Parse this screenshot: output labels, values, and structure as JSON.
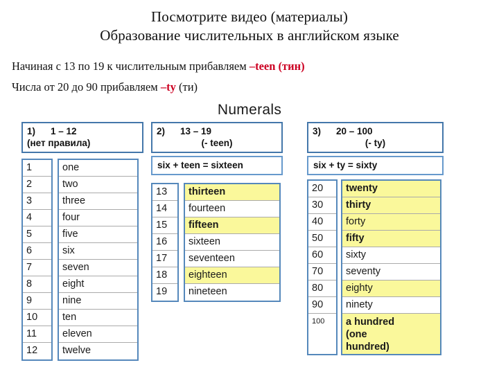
{
  "heading": {
    "line1": "Посмотрите видео (материалы)",
    "line2": "Образование числительных в английском языке"
  },
  "rules": {
    "rule1_prefix": "Начиная с 13 по 19 к числительным прибавляем ",
    "rule1_accent": "–teen (тин)",
    "rule2_prefix": "Числа от 20 до 90 прибавляем ",
    "rule2_accent": "–ty",
    "rule2_suffix": " (ти)"
  },
  "figure": {
    "title": "Numerals",
    "accent_color": "#CC0022",
    "highlight_color": "#FAF89B",
    "border_color": "#5588BB",
    "columns": [
      {
        "index": "1)",
        "range": "1 – 12",
        "subtitle": "(нет правила)",
        "formula": null,
        "rows": [
          {
            "num": "1",
            "word": "one",
            "highlight": false,
            "bold": false
          },
          {
            "num": "2",
            "word": "two",
            "highlight": false,
            "bold": false
          },
          {
            "num": "3",
            "word": "three",
            "highlight": false,
            "bold": false
          },
          {
            "num": "4",
            "word": "four",
            "highlight": false,
            "bold": false
          },
          {
            "num": "5",
            "word": "five",
            "highlight": false,
            "bold": false
          },
          {
            "num": "6",
            "word": "six",
            "highlight": false,
            "bold": false
          },
          {
            "num": "7",
            "word": "seven",
            "highlight": false,
            "bold": false
          },
          {
            "num": "8",
            "word": "eight",
            "highlight": false,
            "bold": false
          },
          {
            "num": "9",
            "word": "nine",
            "highlight": false,
            "bold": false
          },
          {
            "num": "10",
            "word": "ten",
            "highlight": false,
            "bold": false
          },
          {
            "num": "11",
            "word": "eleven",
            "highlight": false,
            "bold": false
          },
          {
            "num": "12",
            "word": "twelve",
            "highlight": false,
            "bold": false
          }
        ]
      },
      {
        "index": "2)",
        "range": "13 – 19",
        "subtitle": "(- teen)",
        "formula": "six + teen = sixteen",
        "rows": [
          {
            "num": "13",
            "word": "thirteen",
            "highlight": true,
            "bold": true
          },
          {
            "num": "14",
            "word": "fourteen",
            "highlight": false,
            "bold": false
          },
          {
            "num": "15",
            "word": "fifteen",
            "highlight": true,
            "bold": true
          },
          {
            "num": "16",
            "word": "sixteen",
            "highlight": false,
            "bold": false
          },
          {
            "num": "17",
            "word": "seventeen",
            "highlight": false,
            "bold": false
          },
          {
            "num": "18",
            "word": "eighteen",
            "highlight": true,
            "bold": false
          },
          {
            "num": "19",
            "word": "nineteen",
            "highlight": false,
            "bold": false
          }
        ]
      },
      {
        "index": "3)",
        "range": "20 – 100",
        "subtitle": "(- ty)",
        "formula": "six + ty = sixty",
        "rows": [
          {
            "num": "20",
            "word": "twenty",
            "highlight": true,
            "bold": true
          },
          {
            "num": "30",
            "word": "thirty",
            "highlight": true,
            "bold": true
          },
          {
            "num": "40",
            "word": "forty",
            "highlight": true,
            "bold": false
          },
          {
            "num": "50",
            "word": "fifty",
            "highlight": true,
            "bold": true
          },
          {
            "num": "60",
            "word": "sixty",
            "highlight": false,
            "bold": false
          },
          {
            "num": "70",
            "word": "seventy",
            "highlight": false,
            "bold": false
          },
          {
            "num": "80",
            "word": "eighty",
            "highlight": true,
            "bold": false
          },
          {
            "num": "90",
            "word": "ninety",
            "highlight": false,
            "bold": false
          },
          {
            "num": "100",
            "word": "a hundred (one hundred)",
            "highlight": true,
            "bold": true,
            "word_lines": [
              "a hundred",
              "(one",
              "hundred)"
            ],
            "tall": true,
            "small_num": true
          }
        ]
      }
    ]
  }
}
